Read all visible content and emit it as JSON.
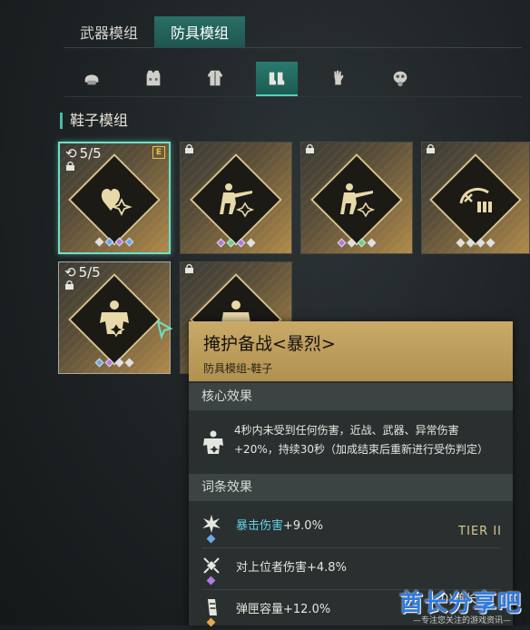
{
  "top_tabs": [
    {
      "label": "武器模组",
      "active": false
    },
    {
      "label": "防具模组",
      "active": true
    }
  ],
  "category_tabs": [
    {
      "icon": "helmet-icon",
      "active": false
    },
    {
      "icon": "vest-icon",
      "active": false
    },
    {
      "icon": "jacket-icon",
      "active": false
    },
    {
      "icon": "boots-icon",
      "active": true
    },
    {
      "icon": "gloves-icon",
      "active": false
    },
    {
      "icon": "gas-mask-icon",
      "active": false
    }
  ],
  "section_title": "鞋子模组",
  "cards": [
    {
      "count": "5/5",
      "equipped_badge": "E",
      "icon": "heart-icon",
      "selected": true,
      "gems": [
        "#e0e0e0",
        "#6aa8e6",
        "#b07ae0",
        "#6aa8e6"
      ]
    },
    {
      "icon": "rifleman-icon",
      "gems": [
        "#b07ae0",
        "#6ad08a",
        "#b07ae0",
        "#e0e0e0"
      ]
    },
    {
      "icon": "rifleman-icon",
      "gems": [
        "#b07ae0",
        "#e0e0e0",
        "#6ad08a",
        "#e0e0e0"
      ]
    },
    {
      "icon": "ammo-icon",
      "gems": [
        "#e0e0e0",
        "#e0e0e0",
        "#e0e0e0",
        "#e0e0e0"
      ]
    },
    {
      "count": "5/5",
      "icon": "muscle-icon",
      "gems": [
        "#6aa8e6",
        "#b07ae0",
        "#e0e0e0",
        "#e0e0e0"
      ]
    },
    {
      "icon": "muscle-icon",
      "gems": []
    }
  ],
  "tooltip": {
    "title": "掩护备战<暴烈>",
    "subtitle": "防具模组-鞋子",
    "core_label": "核心效果",
    "core_text": "4秒内未受到任何伤害，近战、武器、异常伤害+20%，持续30秒（加成结束后重新进行受伤判定）",
    "affix_label": "词条效果",
    "affixes": [
      {
        "icon": "burst-icon",
        "highlight": "暴击伤害",
        "value": "+9.0%",
        "gem": "#6aa8e6",
        "tier": "TIER II"
      },
      {
        "icon": "target-icon",
        "highlight": "",
        "value": "对上位者伤害+4.8%",
        "gem": "#b07ae0",
        "tier": ""
      },
      {
        "icon": "magazine-icon",
        "highlight": "",
        "value": "弹匣容量+12.0%",
        "gem": "#e6a84a",
        "tier": ""
      }
    ]
  },
  "watermark": {
    "main": "酋长分享吧",
    "sub": "—专注您关注的游戏资讯—",
    "overlay": "0)酋长"
  }
}
